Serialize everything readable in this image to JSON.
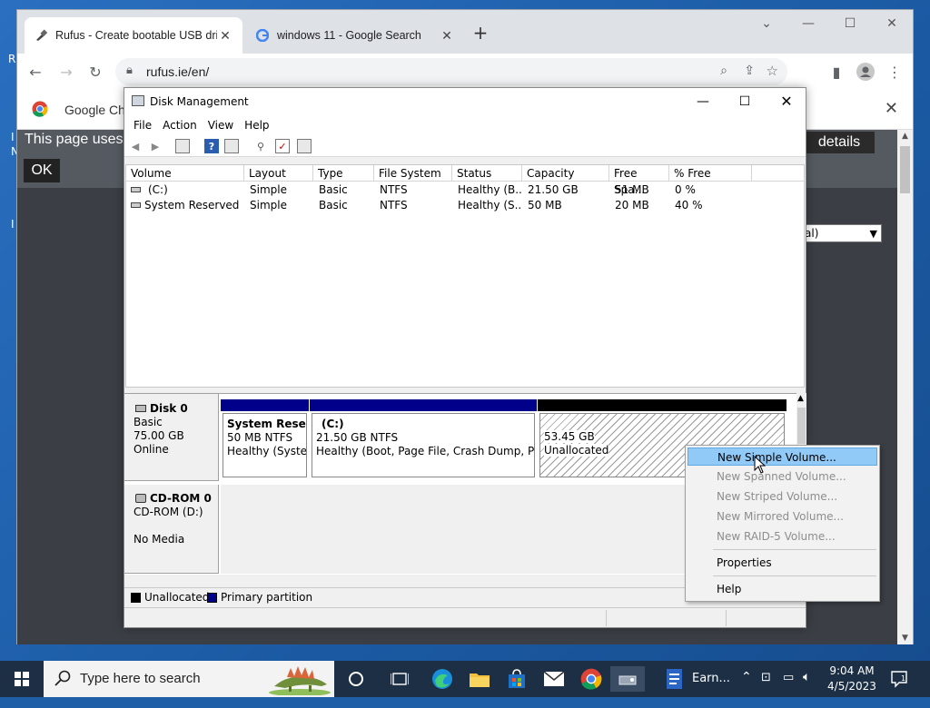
{
  "desktop": {
    "frag_r": "R",
    "frag_n": "N",
    "frag_i1": "I",
    "frag_i2": "I"
  },
  "chrome": {
    "tabs": [
      {
        "title": "Rufus - Create bootable USB drive",
        "close": "✕"
      },
      {
        "title": "windows 11 - Google Search",
        "close": "✕"
      }
    ],
    "new_tab": "+",
    "url": "rufus.ie/en/",
    "infobar_text": "Google Chr",
    "page": {
      "cookie_text": "This page uses",
      "details_label": "details",
      "ok_label": "OK",
      "select_value": "al)"
    }
  },
  "disk_mgmt": {
    "title": "Disk Management",
    "menu": [
      "File",
      "Action",
      "View",
      "Help"
    ],
    "columns": [
      "Volume",
      "Layout",
      "Type",
      "File System",
      "Status",
      "Capacity",
      "Free Spa...",
      "% Free"
    ],
    "volumes": [
      {
        "volume": "(C:)",
        "layout": "Simple",
        "type": "Basic",
        "fs": "NTFS",
        "status": "Healthy (B...",
        "capacity": "21.50 GB",
        "free": "51 MB",
        "pct": "0 %"
      },
      {
        "volume": "System Reserved",
        "layout": "Simple",
        "type": "Basic",
        "fs": "NTFS",
        "status": "Healthy (S...",
        "capacity": "50 MB",
        "free": "20 MB",
        "pct": "40 %"
      }
    ],
    "disk0": {
      "name": "Disk 0",
      "type": "Basic",
      "size": "75.00 GB",
      "state": "Online",
      "parts": [
        {
          "name": "System Reserv",
          "size": "50 MB NTFS",
          "status": "Healthy (Systen"
        },
        {
          "name": "(C:)",
          "size": "21.50 GB NTFS",
          "status": "Healthy (Boot, Page File, Crash Dump, Prima"
        },
        {
          "size": "53.45 GB",
          "status": "Unallocated"
        }
      ]
    },
    "cdrom0": {
      "name": "CD-ROM 0",
      "drive": "CD-ROM (D:)",
      "media": "No Media"
    },
    "legend": {
      "unallocated": "Unallocated",
      "primary": "Primary partition"
    },
    "colors": {
      "primary": "#00008b",
      "unallocated": "#000000"
    }
  },
  "context_menu": {
    "items": [
      {
        "label": "New Simple Volume...",
        "enabled": true
      },
      {
        "label": "New Spanned Volume...",
        "enabled": false
      },
      {
        "label": "New Striped Volume...",
        "enabled": false
      },
      {
        "label": "New Mirrored Volume...",
        "enabled": false
      },
      {
        "label": "New RAID-5 Volume...",
        "enabled": false
      },
      {
        "label": "Properties",
        "enabled": true
      },
      {
        "label": "Help",
        "enabled": true
      }
    ]
  },
  "taskbar": {
    "search_placeholder": "Type here to search",
    "app_label": "Earn...",
    "time": "9:04 AM",
    "date": "4/5/2023"
  }
}
